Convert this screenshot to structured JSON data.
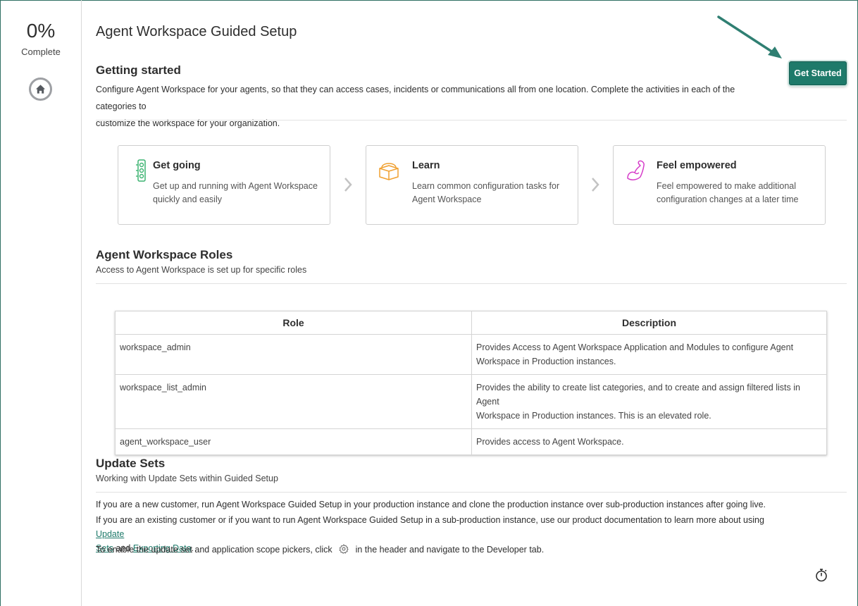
{
  "sidebar": {
    "progress_value": "0%",
    "progress_label": "Complete",
    "home_icon": "home-icon"
  },
  "page": {
    "title": "Agent Workspace Guided Setup"
  },
  "getting_started": {
    "title": "Getting started",
    "line1": "Configure Agent Workspace for your agents, so that they can access cases, incidents or communications all from one location. Complete the activities in each of the categories to",
    "line2": "customize the workspace for your organization.",
    "button_label": "Get Started"
  },
  "steps": [
    {
      "title": "Get going",
      "desc1": "Get up and running with Agent Workspace",
      "desc2": "quickly and easily",
      "icon": "traffic-light-icon"
    },
    {
      "title": "Learn",
      "desc1": "Learn common configuration tasks for",
      "desc2": "Agent Workspace",
      "icon": "box-icon"
    },
    {
      "title": "Feel empowered",
      "desc1": "Feel empowered to make additional",
      "desc2": "configuration changes at a later time",
      "icon": "flexed-arm-icon"
    }
  ],
  "roles": {
    "title": "Agent Workspace Roles",
    "subtitle": "Access to Agent Workspace is set up for specific roles",
    "headers": [
      "Role",
      "Description"
    ],
    "rows": [
      {
        "role": "workspace_admin",
        "desc1": "Provides Access to Agent Workspace Application and Modules to configure Agent",
        "desc2": "Workspace in Production instances."
      },
      {
        "role": "workspace_list_admin",
        "desc1": "Provides the ability to create list categories, and to create and assign filtered lists in Agent",
        "desc2": "Workspace in Production instances. This is an elevated role."
      },
      {
        "role": "agent_workspace_user",
        "desc1": "Provides access to Agent Workspace.",
        "desc2": ""
      }
    ]
  },
  "update_sets": {
    "title": "Update Sets",
    "subtitle": "Working with Update Sets within Guided Setup",
    "para1": "If you are a new customer, run Agent Workspace Guided Setup in your production instance and clone the production instance over sub-production instances after going live.",
    "para2_prefix": "If you are an existing customer or if you want to run Agent Workspace Guided Setup in a sub-production instance, use our product documentation to learn more about using",
    "link_update_1": "Update",
    "link_update_2": "Sets",
    "and_text": "and",
    "link_exporting": "Exporting Data",
    "period": ".",
    "para3_prefix": "To enable the update set and application scope pickers, click",
    "para3_suffix": "in the header and navigate to the Developer tab."
  },
  "colors": {
    "accent": "#1e7a6a",
    "step1_icon": "#3cb371",
    "step2_icon": "#f0a030",
    "step3_icon": "#d63cc9"
  }
}
